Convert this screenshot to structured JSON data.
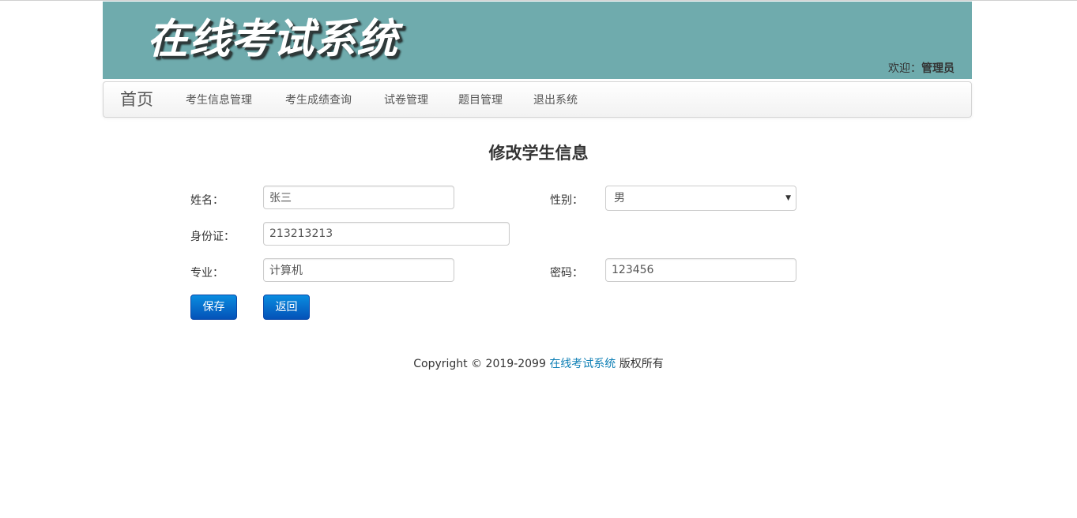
{
  "header": {
    "logo_text": "在线考试系统",
    "welcome_prefix": "欢迎：",
    "welcome_user": "管理员"
  },
  "nav": {
    "brand": "首页",
    "items": [
      {
        "label": "考生信息管理"
      },
      {
        "label": "考生成绩查询"
      },
      {
        "label": "试卷管理"
      },
      {
        "label": "题目管理"
      },
      {
        "label": "退出系统"
      }
    ]
  },
  "form": {
    "title": "修改学生信息",
    "name_label": "姓名：",
    "name_value": "张三",
    "gender_label": "性别：",
    "gender_value": "男",
    "id_label": "身份证：",
    "id_value": "213213213",
    "major_label": "专业：",
    "major_value": "计算机",
    "password_label": "密码：",
    "password_value": "123456",
    "save_label": "保存",
    "back_label": "返回"
  },
  "footer": {
    "prefix": "Copyright © 2019-2099",
    "link_text": "在线考试系统",
    "suffix": "版权所有"
  },
  "colors": {
    "banner": "#6fabad",
    "button": "#0452b8",
    "link": "#0e7fb5"
  }
}
